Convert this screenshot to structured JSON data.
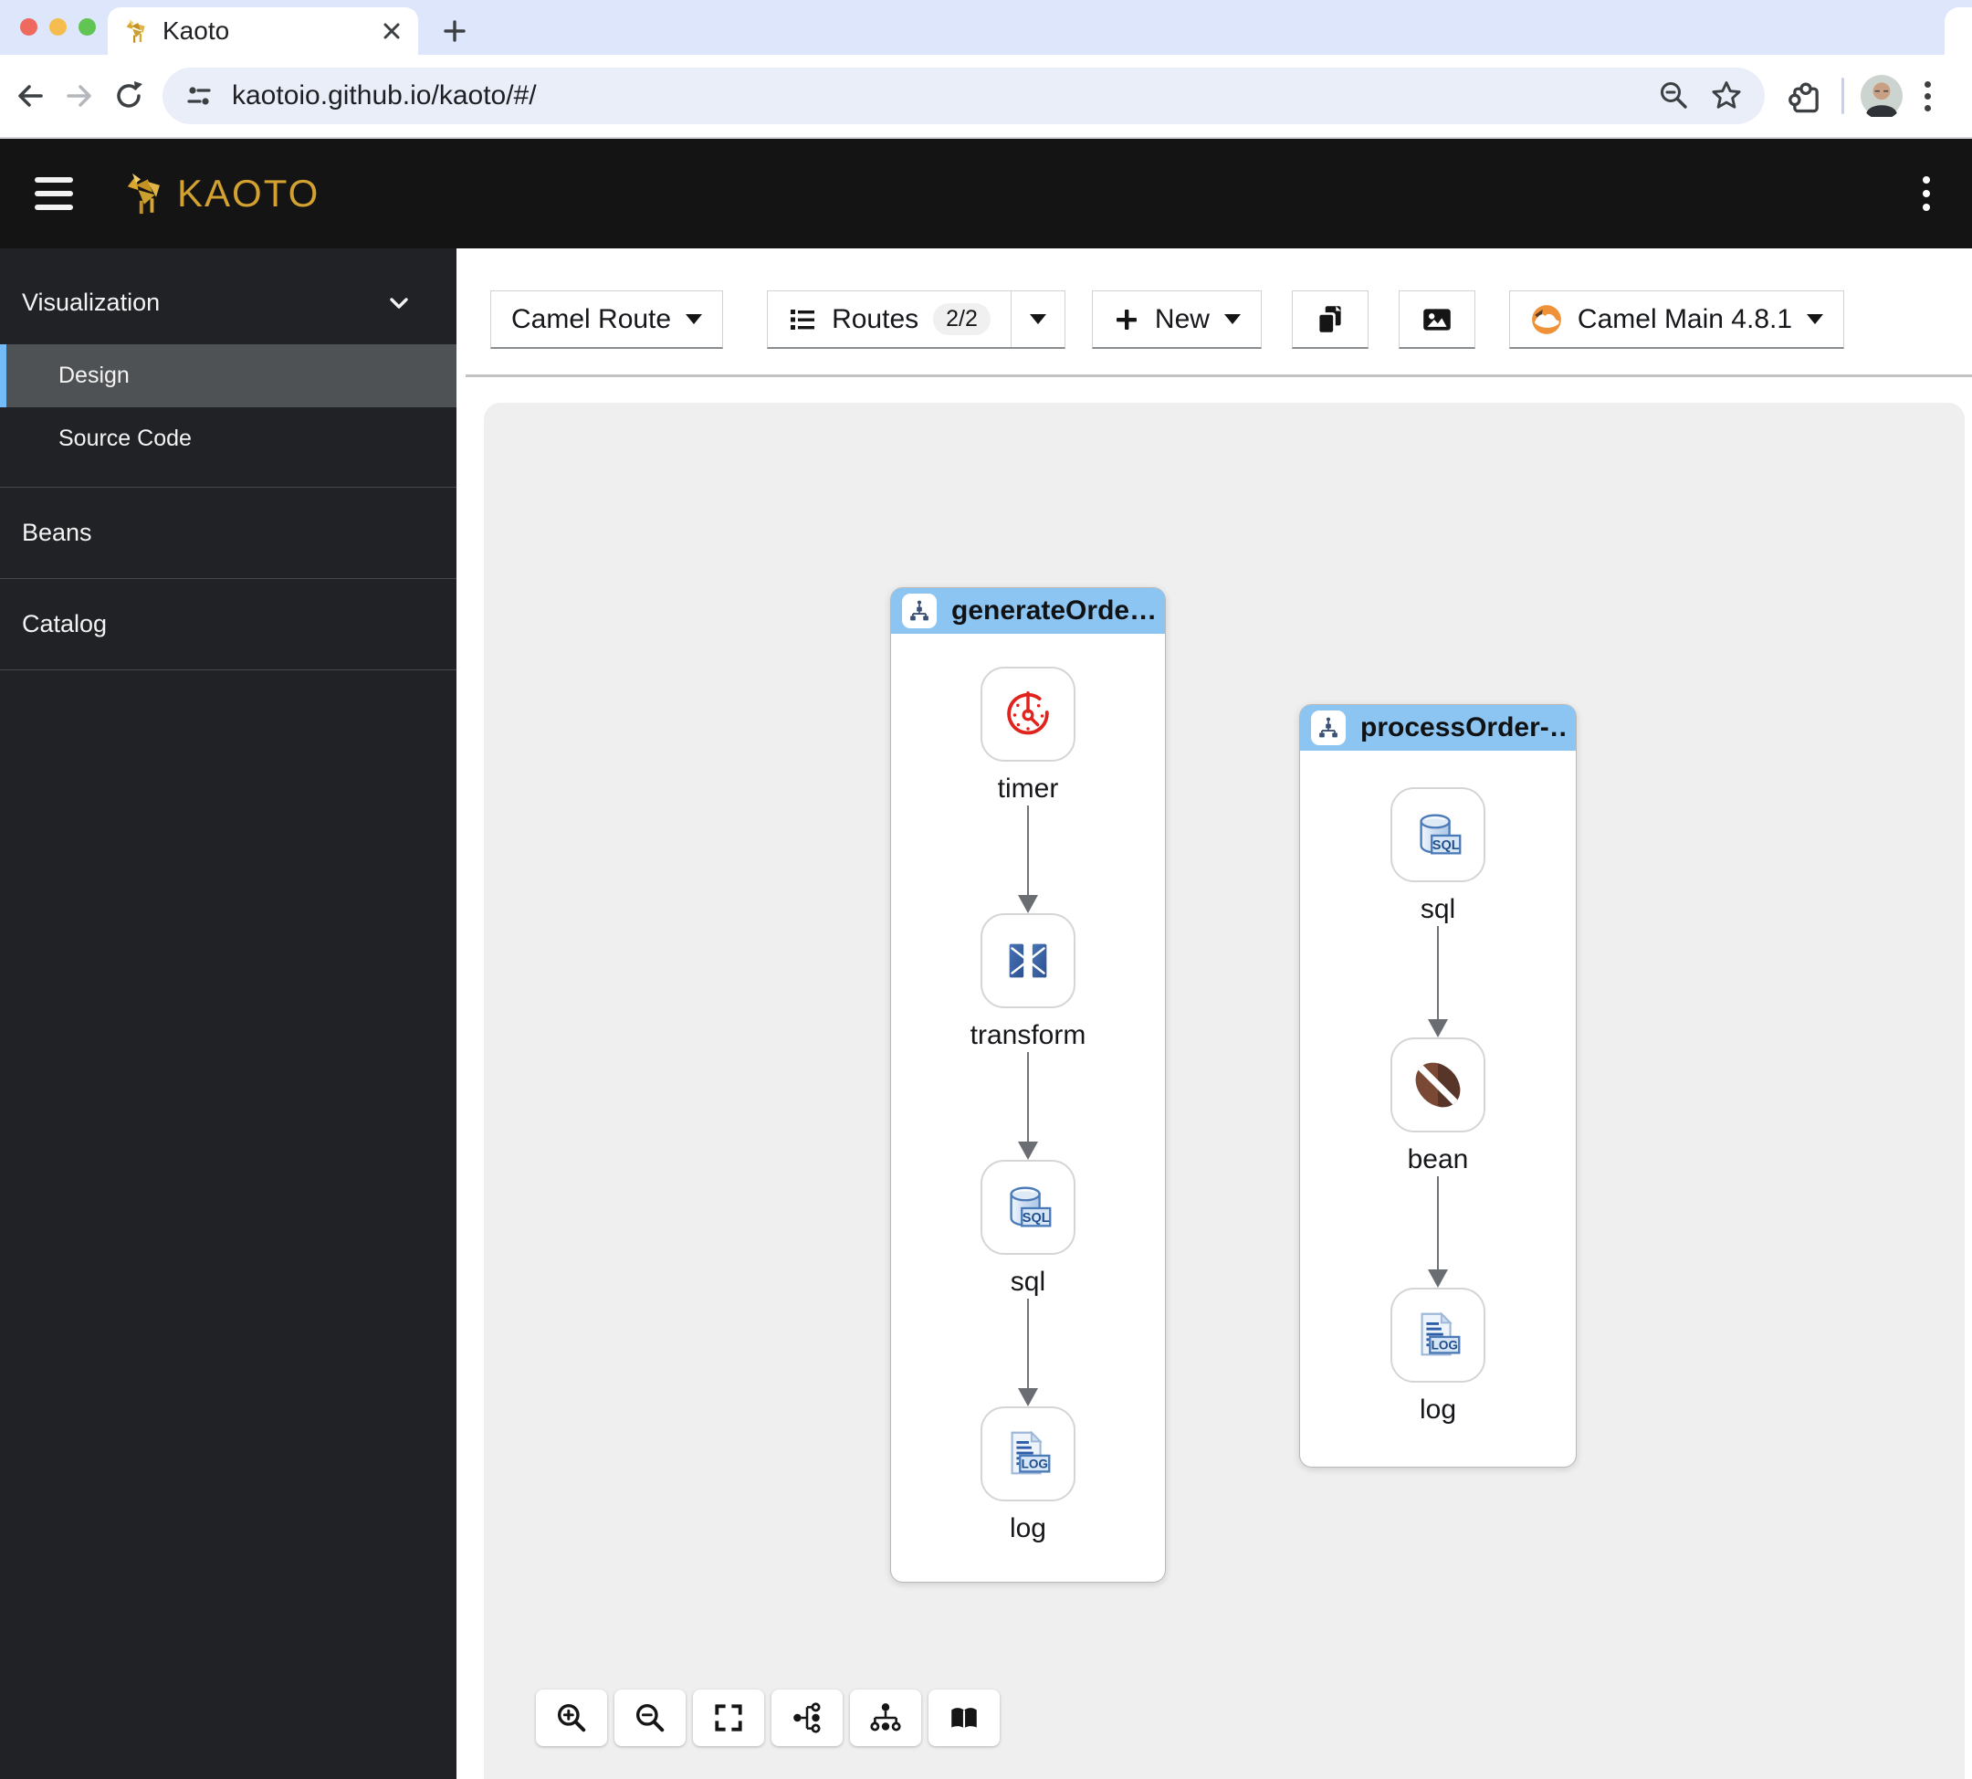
{
  "colors": {
    "route_header_blue": "#8cc4f2",
    "sidebar_selected_bar": "#73bcf7",
    "brand_gold": "#d2a12f",
    "canvas_bg": "#efefef",
    "camel_orange": "#ef9137"
  },
  "browser": {
    "tab_title": "Kaoto",
    "url": "kaotoio.github.io/kaoto/#/"
  },
  "app_header": {
    "brand": "KAOTO"
  },
  "sidebar": {
    "visualization_label": "Visualization",
    "items": [
      {
        "label": "Design",
        "selected": true
      },
      {
        "label": "Source Code",
        "selected": false
      }
    ],
    "sections": [
      {
        "label": "Beans"
      },
      {
        "label": "Catalog"
      }
    ]
  },
  "toolbar": {
    "dsl_label": "Camel Route",
    "flows_label": "Routes",
    "flows_count": "2/2",
    "new_label": "New",
    "runtime_label": "Camel Main 4.8.1"
  },
  "canvas": {
    "routes": [
      {
        "title": "generateOrde…",
        "steps": [
          {
            "name": "timer"
          },
          {
            "name": "transform"
          },
          {
            "name": "sql"
          },
          {
            "name": "log"
          }
        ]
      },
      {
        "title": "processOrder-…",
        "steps": [
          {
            "name": "sql"
          },
          {
            "name": "bean"
          },
          {
            "name": "log"
          }
        ]
      }
    ]
  }
}
